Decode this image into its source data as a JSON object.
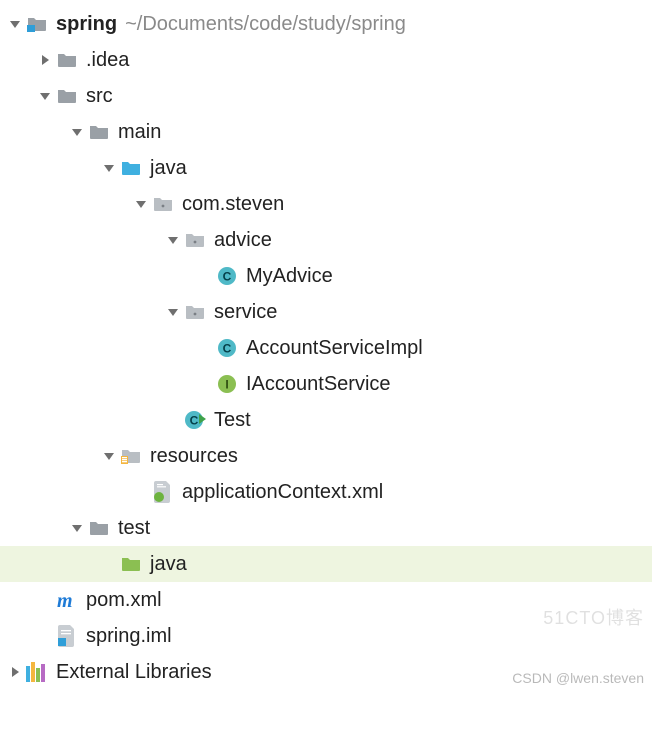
{
  "root": {
    "name": "spring",
    "path": "~/Documents/code/study/spring"
  },
  "nodes": {
    "idea": ".idea",
    "src": "src",
    "main": "main",
    "java_main": "java",
    "pkg": "com.steven",
    "advice": "advice",
    "myadvice": "MyAdvice",
    "service": "service",
    "accountimpl": "AccountServiceImpl",
    "iaccount": "IAccountService",
    "test_class": "Test",
    "resources": "resources",
    "appctx": "applicationContext.xml",
    "test_dir": "test",
    "java_test": "java",
    "pom": "pom.xml",
    "iml": "spring.iml",
    "extlib": "External Libraries"
  },
  "watermarks": {
    "side": "51CTO博客",
    "bottom": "CSDN @lwen.steven"
  }
}
